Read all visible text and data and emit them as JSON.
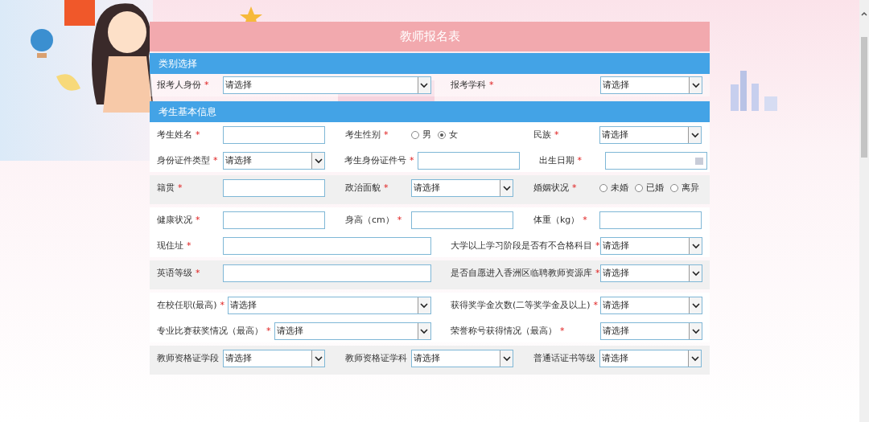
{
  "title": "教师报名表",
  "sections": [
    {
      "heading": "类别选择",
      "groups": [
        {
          "shaded": false,
          "rows": [
            {
              "fields": [
                {
                  "label": "报考人身份",
                  "mark": "*",
                  "kind": "select",
                  "value": "请选择"
                },
                {
                  "label": "报考学科",
                  "mark": "*",
                  "kind": "select",
                  "value": "请选择"
                }
              ]
            }
          ]
        }
      ]
    },
    {
      "heading": "考生基本信息",
      "groups": [
        {
          "shaded": false,
          "rows": [
            {
              "fields": [
                {
                  "label": "考生姓名",
                  "mark": "*",
                  "kind": "text"
                },
                {
                  "label": "考生性别",
                  "mark": "*",
                  "kind": "radio",
                  "options": [
                    {
                      "label": "男",
                      "selected": false
                    },
                    {
                      "label": "女",
                      "selected": true
                    }
                  ]
                },
                {
                  "label": "民族",
                  "mark": "*",
                  "kind": "select",
                  "value": "请选择"
                }
              ]
            },
            {
              "fields": [
                {
                  "label": "身份证件类型",
                  "mark": "*",
                  "kind": "select",
                  "value": "请选择"
                },
                {
                  "label": "考生身份证件号",
                  "mark": "*",
                  "kind": "text"
                },
                {
                  "label": "出生日期",
                  "mark": "*",
                  "kind": "date"
                }
              ]
            }
          ]
        },
        {
          "shaded": true,
          "rows": [
            {
              "fields": [
                {
                  "label": "籍贯",
                  "mark": "*",
                  "kind": "text"
                },
                {
                  "label": "政治面貌",
                  "mark": "*",
                  "kind": "select",
                  "value": "请选择"
                },
                {
                  "label": "婚姻状况",
                  "mark": "*",
                  "kind": "radio",
                  "options": [
                    {
                      "label": "未婚",
                      "selected": false
                    },
                    {
                      "label": "已婚",
                      "selected": false
                    },
                    {
                      "label": "离异",
                      "selected": false
                    }
                  ]
                }
              ]
            }
          ]
        },
        {
          "shaded": false,
          "rows": [
            {
              "fields": [
                {
                  "label": "健康状况",
                  "mark": "*",
                  "kind": "text"
                },
                {
                  "label": "身高（cm）",
                  "mark": "*",
                  "kind": "text"
                },
                {
                  "label": "体重（kg）",
                  "mark": "*",
                  "kind": "text"
                }
              ]
            },
            {
              "fields": [
                {
                  "label": "现住址",
                  "mark": "*",
                  "kind": "text"
                },
                {
                  "label": "大学以上学习阶段是否有不合格科目",
                  "mark": "*",
                  "kind": "select",
                  "value": "请选择"
                }
              ]
            }
          ]
        },
        {
          "shaded": true,
          "rows": [
            {
              "fields": [
                {
                  "label": "英语等级",
                  "mark": "*",
                  "kind": "text"
                },
                {
                  "label": "是否自愿进入香洲区临聘教师资源库",
                  "mark": "*",
                  "kind": "select",
                  "value": "请选择"
                }
              ]
            }
          ]
        },
        {
          "shaded": false,
          "rows": [
            {
              "fields": [
                {
                  "label": "在校任职(最高)",
                  "mark": "*",
                  "kind": "select",
                  "value": "请选择"
                },
                {
                  "label": "获得奖学金次数(二等奖学金及以上)",
                  "mark": "*",
                  "kind": "select",
                  "value": "请选择"
                }
              ]
            },
            {
              "fields": [
                {
                  "label": "专业比赛获奖情况（最高）",
                  "mark": "*",
                  "kind": "select",
                  "value": "请选择"
                },
                {
                  "label": "荣誉称号获得情况（最高）",
                  "mark": "*",
                  "kind": "select",
                  "value": "请选择"
                }
              ]
            }
          ]
        },
        {
          "shaded": true,
          "rows": [
            {
              "fields": [
                {
                  "label": "教师资格证学段",
                  "kind": "select",
                  "value": "请选择"
                },
                {
                  "label": "教师资格证学科",
                  "kind": "select",
                  "value": "请选择"
                },
                {
                  "label": "普通话证书等级",
                  "kind": "select",
                  "value": "请选择"
                }
              ]
            }
          ]
        }
      ]
    }
  ]
}
